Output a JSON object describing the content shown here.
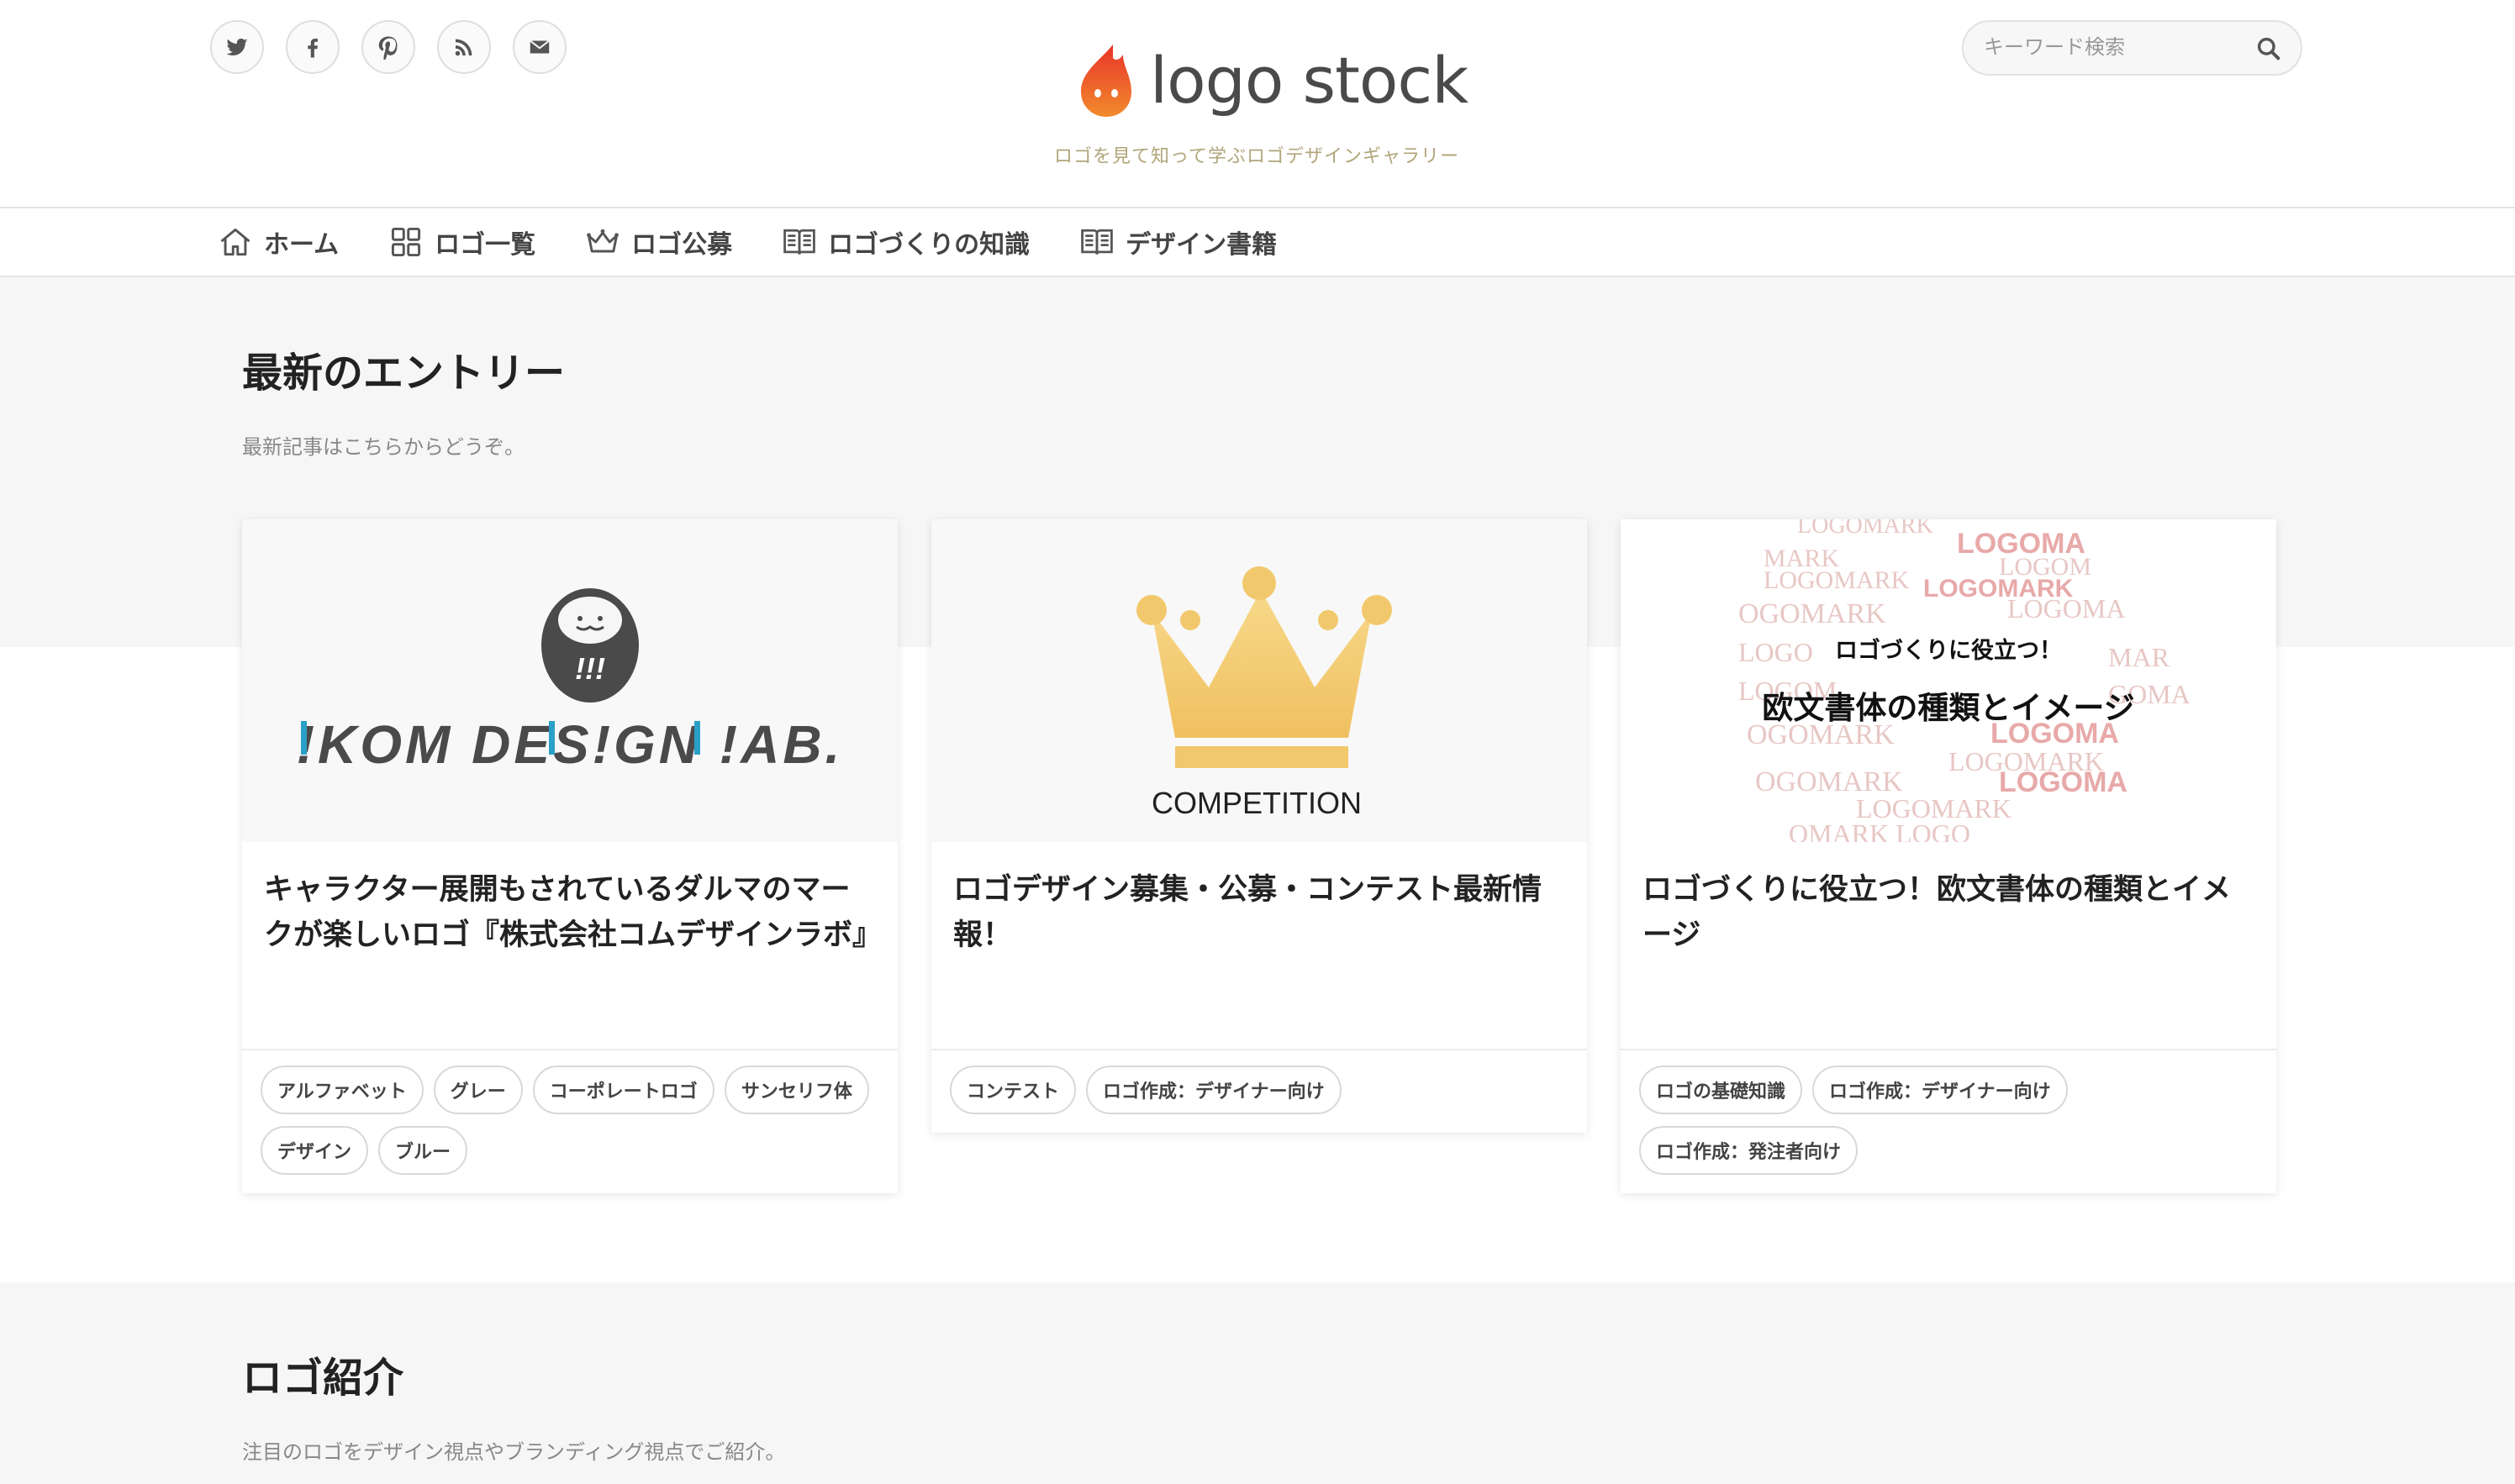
{
  "header": {
    "site_name": "logo stock",
    "tagline": "ロゴを見て知って学ぶロゴデザインギャラリー",
    "search_placeholder": "キーワード検索",
    "social": [
      "twitter-icon",
      "facebook-icon",
      "pinterest-icon",
      "rss-icon",
      "mail-icon"
    ]
  },
  "nav": {
    "items": [
      {
        "label": "ホーム",
        "icon": "home-icon"
      },
      {
        "label": "ロゴ一覧",
        "icon": "grid-icon"
      },
      {
        "label": "ロゴ公募",
        "icon": "crown-icon"
      },
      {
        "label": "ロゴづくりの知識",
        "icon": "book-icon"
      },
      {
        "label": "デザイン書籍",
        "icon": "book-icon"
      }
    ]
  },
  "latest": {
    "title": "最新のエントリー",
    "subtitle": "最新記事はこちらからどうぞ。"
  },
  "cards": [
    {
      "thumb_text": "!KOM DES!GN !AB.",
      "title": "キャラクター展開もされているダルマのマークが楽しいロゴ『株式会社コムデザインラボ』",
      "tags": [
        "アルファベット",
        "グレー",
        "コーポレートロゴ",
        "サンセリフ体",
        "デザイン",
        "ブルー"
      ]
    },
    {
      "thumb_text": "COMPETITION",
      "title": "ロゴデザイン募集・公募・コンテスト最新情報！",
      "tags": [
        "コンテスト",
        "ロゴ作成：デザイナー向け"
      ]
    },
    {
      "thumb_line1": "ロゴづくりに役立つ！",
      "thumb_line2": "欧文書体の種類とイメージ",
      "title": "ロゴづくりに役立つ！欧文書体の種類とイメージ",
      "tags": [
        "ロゴの基礎知識",
        "ロゴ作成：デザイナー向け",
        "ロゴ作成：発注者向け"
      ]
    }
  ],
  "logo_intro": {
    "title": "ロゴ紹介",
    "subtitle": "注目のロゴをデザイン視点やブランディング視点でご紹介。"
  },
  "colors": {
    "accent_orange": "#e8502a",
    "crown_gold": "#f2c86c",
    "kom_blue": "#2aa0c8",
    "band_bg": "#f6f6f6"
  }
}
